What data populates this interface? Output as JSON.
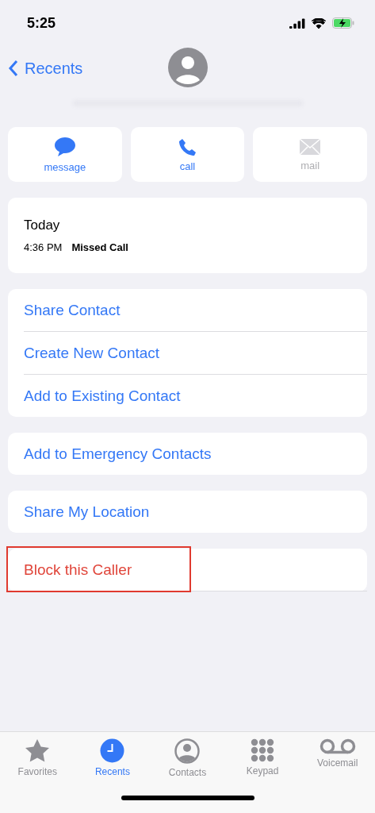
{
  "status_bar": {
    "time": "5:25"
  },
  "nav": {
    "back_label": "Recents"
  },
  "actions": [
    {
      "kind": "message",
      "label": "message",
      "disabled": false
    },
    {
      "kind": "call",
      "label": "call",
      "disabled": false
    },
    {
      "kind": "mail",
      "label": "mail",
      "disabled": true
    }
  ],
  "call_log": {
    "day": "Today",
    "time": "4:36 PM",
    "type": "Missed Call"
  },
  "groups": [
    {
      "items": [
        {
          "label": "Share Contact",
          "destructive": false,
          "highlighted": false
        },
        {
          "label": "Create New Contact",
          "destructive": false,
          "highlighted": false
        },
        {
          "label": "Add to Existing Contact",
          "destructive": false,
          "highlighted": false
        }
      ]
    },
    {
      "items": [
        {
          "label": "Add to Emergency Contacts",
          "destructive": false,
          "highlighted": false
        }
      ]
    },
    {
      "items": [
        {
          "label": "Share My Location",
          "destructive": false,
          "highlighted": false
        }
      ]
    },
    {
      "items": [
        {
          "label": "Block this Caller",
          "destructive": true,
          "highlighted": true
        }
      ]
    }
  ],
  "tab_bar": [
    {
      "kind": "favorites",
      "label": "Favorites",
      "selected": false
    },
    {
      "kind": "recents",
      "label": "Recents",
      "selected": true
    },
    {
      "kind": "contacts",
      "label": "Contacts",
      "selected": false
    },
    {
      "kind": "keypad",
      "label": "Keypad",
      "selected": false
    },
    {
      "kind": "voicemail",
      "label": "Voicemail",
      "selected": false
    }
  ]
}
